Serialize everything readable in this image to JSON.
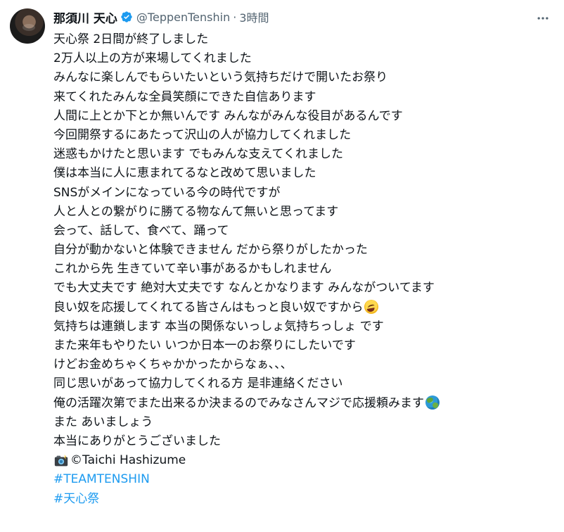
{
  "post": {
    "display_name": "那須川 天心",
    "handle": "@TeppenTenshin",
    "separator": "·",
    "time": "3時間",
    "lines": [
      "天心祭 2日間が終了しました",
      "2万人以上の方が来場してくれました",
      "みんなに楽しんでもらいたいという気持ちだけで開いたお祭り",
      "来てくれたみんな全員笑顔にできた自信あります",
      "人間に上とか下とか無いんです みんながみんな役目があるんです",
      "今回開祭するにあたって沢山の人が協力してくれました",
      "迷惑もかけたと思います でもみんな支えてくれました",
      "僕は本当に人に恵まれてるなと改めて思いました",
      "SNSがメインになっている今の時代ですが",
      "人と人との繋がりに勝てる物なんて無いと思ってます",
      "会って、話して、食べて、踊って",
      "自分が動かないと体験できません だから祭りがしたかった",
      "これから先 生きていて辛い事があるかもしれません",
      "でも大丈夫です 絶対大丈夫です なんとかなります みんながついてます",
      "良い奴を応援してくれてる皆さんはもっと良い奴ですから",
      "気持ちは連鎖します 本当の関係ないっしょ気持ちっしょ です",
      "また来年もやりたい いつか日本一のお祭りにしたいです",
      "けどお金めちゃくちゃかかったからなぁ、、、",
      "同じ思いがあって協力してくれる方 是非連絡ください",
      "俺の活躍次第でまた出来るか決まるのでみなさんマジで応援頼みます",
      "また あいましょう",
      "本当にありがとうございました"
    ],
    "credit": "©Taichi Hashizume",
    "hashtags": [
      "#TEAMTENSHIN",
      "#天心祭"
    ]
  },
  "icons": {
    "verified": "verified-badge-icon",
    "more": "more-options-icon",
    "camera": "camera-with-flash-icon",
    "laugh": "rolling-on-floor-laughing-icon",
    "globe": "globe-icon"
  },
  "colors": {
    "text": "#0f1419",
    "secondary": "#536471",
    "link": "#1d9bf0"
  }
}
